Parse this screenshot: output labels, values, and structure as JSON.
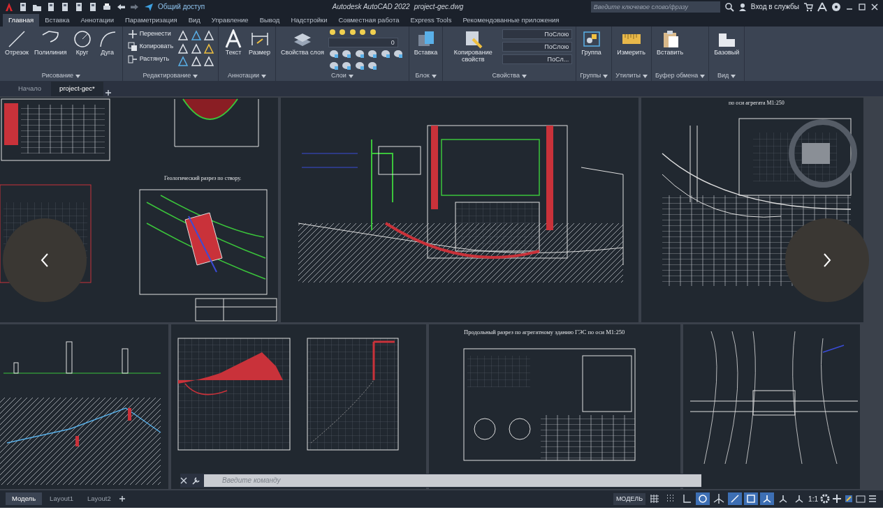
{
  "window": {
    "title": "Autodesk AutoCAD 2022",
    "file": "project-gec.dwg"
  },
  "quick_access": {
    "share": "Общий доступ"
  },
  "search": {
    "placeholder": "Введите ключевое слово/фразу"
  },
  "sign_in": "Вход в службы",
  "ribbon_tabs": [
    {
      "label": "Главная",
      "selected": true
    },
    {
      "label": "Вставка",
      "selected": false
    },
    {
      "label": "Аннотации",
      "selected": false
    },
    {
      "label": "Параметризация",
      "selected": false
    },
    {
      "label": "Вид",
      "selected": false
    },
    {
      "label": "Управление",
      "selected": false
    },
    {
      "label": "Вывод",
      "selected": false
    },
    {
      "label": "Надстройки",
      "selected": false
    },
    {
      "label": "Совместная работа",
      "selected": false
    },
    {
      "label": "Express Tools",
      "selected": false
    },
    {
      "label": "Рекомендованные приложения",
      "selected": false
    }
  ],
  "panels": [
    {
      "title": "Рисование",
      "large": [
        "Отрезок",
        "Полилиния",
        "Круг",
        "Дуга"
      ]
    },
    {
      "title": "Редактирование",
      "small": [
        "Перенести",
        "Копировать",
        "Растянуть"
      ]
    },
    {
      "title": "Аннотации",
      "large": [
        "Текст",
        "Размер"
      ]
    },
    {
      "title": "Слои",
      "large": [
        "Свойства слоя"
      ],
      "dropdowns": [
        "0"
      ]
    },
    {
      "title": "Блок",
      "large": [
        "Вставка"
      ]
    },
    {
      "title": "Свойства",
      "large": [
        "Копирование свойств"
      ],
      "dropdowns": [
        "ПоСлою",
        "ПоСлою",
        "ПоСл..."
      ]
    },
    {
      "title": "Группы",
      "large": [
        "Группа"
      ]
    },
    {
      "title": "Утилиты",
      "large": [
        "Измерить"
      ]
    },
    {
      "title": "Буфер обмена",
      "large": [
        "Вставить"
      ]
    },
    {
      "title": "Вид",
      "large": [
        "Базовый"
      ]
    }
  ],
  "doc_tabs": [
    {
      "label": "Начало",
      "selected": false
    },
    {
      "label": "project-gec*",
      "selected": true
    }
  ],
  "drawing_captions": [
    "Геологический разрез по створу.",
    "по оси агрегата М1:250",
    "Продольный разрез по агрегатному зданию ГЭС по оси М1:250"
  ],
  "command_line": {
    "placeholder": "Введите команду"
  },
  "layout_tabs": [
    {
      "label": "Модель",
      "selected": true
    },
    {
      "label": "Layout1",
      "selected": false
    },
    {
      "label": "Layout2",
      "selected": false
    }
  ],
  "status_bar": {
    "space": "МОДЕЛЬ",
    "scale": "1:1",
    "toggles": [
      {
        "on": false
      },
      {
        "on": false
      },
      {
        "on": false
      },
      {
        "on": true
      },
      {
        "on": false
      },
      {
        "on": true
      },
      {
        "on": true
      },
      {
        "on": true
      },
      {
        "on": false
      },
      {
        "on": false
      }
    ]
  }
}
